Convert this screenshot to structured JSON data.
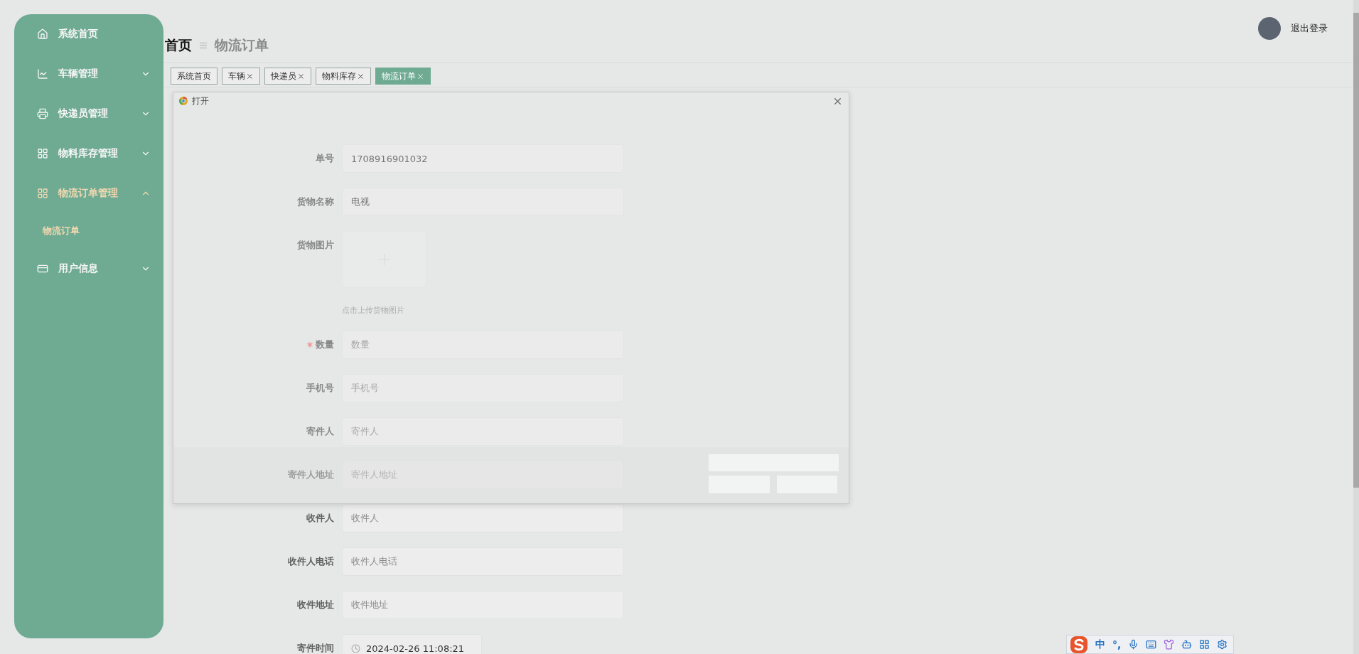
{
  "sidebar": {
    "items": [
      {
        "label": "系统首页",
        "kind": "link",
        "selected": false
      },
      {
        "label": "车辆管理",
        "kind": "group",
        "selected": false,
        "expanded": false
      },
      {
        "label": "快递员管理",
        "kind": "group",
        "selected": false,
        "expanded": false
      },
      {
        "label": "物料库存管理",
        "kind": "group",
        "selected": false,
        "expanded": false
      },
      {
        "label": "物流订单管理",
        "kind": "group",
        "selected": true,
        "expanded": true,
        "children": [
          {
            "label": "物流订单",
            "selected": true
          }
        ]
      },
      {
        "label": "用户信息",
        "kind": "group",
        "selected": false,
        "expanded": false
      }
    ]
  },
  "header": {
    "breadcrumb": [
      "首页",
      "物流订单"
    ],
    "logout": "退出登录"
  },
  "tabs": [
    {
      "label": "系统首页",
      "closable": false,
      "selected": false
    },
    {
      "label": "车辆",
      "closable": true,
      "selected": false
    },
    {
      "label": "快递员",
      "closable": true,
      "selected": false
    },
    {
      "label": "物料库存",
      "closable": true,
      "selected": false
    },
    {
      "label": "物流订单",
      "closable": true,
      "selected": true
    }
  ],
  "form": {
    "fields": [
      {
        "kind": "input",
        "label": "单号",
        "value": "1708916901032",
        "required": false
      },
      {
        "kind": "input",
        "label": "货物名称",
        "value": "电视",
        "required": false
      },
      {
        "kind": "upload",
        "label": "货物图片",
        "hint": "点击上传货物图片",
        "required": false
      },
      {
        "kind": "input",
        "label": "数量",
        "placeholder": "数量",
        "required": true
      },
      {
        "kind": "input",
        "label": "手机号",
        "placeholder": "手机号",
        "required": false
      },
      {
        "kind": "input",
        "label": "寄件人",
        "placeholder": "寄件人",
        "required": false
      },
      {
        "kind": "input",
        "label": "寄件人地址",
        "placeholder": "寄件人地址",
        "required": false
      },
      {
        "kind": "input",
        "label": "收件人",
        "placeholder": "收件人",
        "required": false
      },
      {
        "kind": "input",
        "label": "收件人电话",
        "placeholder": "收件人电话",
        "required": false
      },
      {
        "kind": "input",
        "label": "收件地址",
        "placeholder": "收件地址",
        "required": false
      },
      {
        "kind": "date",
        "label": "寄件时间",
        "value": "2024-02-26 11:08:21",
        "required": false
      }
    ]
  },
  "dialog": {
    "title": "打开"
  },
  "ime_toolbar": {
    "items": [
      {
        "kind": "logo"
      },
      {
        "kind": "text",
        "text": "中"
      },
      {
        "kind": "text",
        "text": "°,"
      },
      {
        "kind": "mic"
      },
      {
        "kind": "keyboard"
      },
      {
        "kind": "shirt"
      },
      {
        "kind": "bot"
      },
      {
        "kind": "grid"
      },
      {
        "kind": "settings"
      }
    ]
  }
}
